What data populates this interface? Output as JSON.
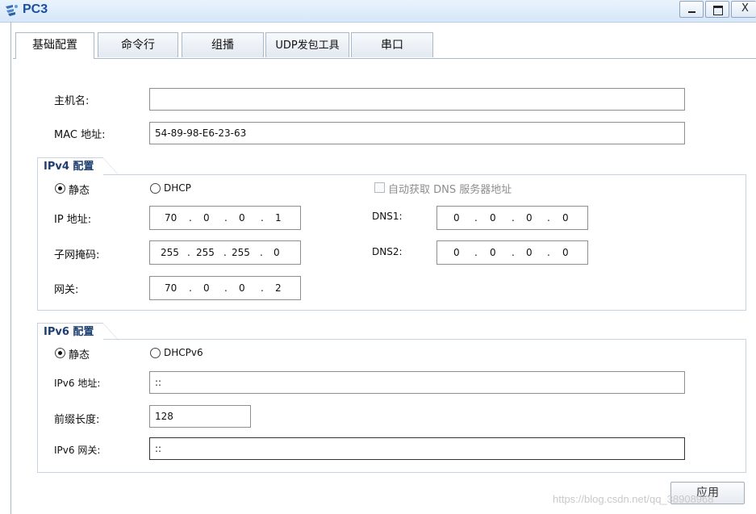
{
  "window": {
    "title": "PC3",
    "minimize_glyph": "_",
    "maximize_glyph": "□",
    "close_glyph": "X"
  },
  "tabs": [
    {
      "label": "基础配置",
      "active": true
    },
    {
      "label": "命令行",
      "active": false
    },
    {
      "label": "组播",
      "active": false
    },
    {
      "label": "UDP发包工具",
      "active": false
    },
    {
      "label": "串口",
      "active": false
    }
  ],
  "basic": {
    "hostname_label": "主机名:",
    "hostname_value": "",
    "mac_label": "MAC 地址:",
    "mac_value": "54-89-98-E6-23-63"
  },
  "ipv4": {
    "group_title": "IPv4 配置",
    "static_label": "静态",
    "dhcp_label": "DHCP",
    "mode": "static",
    "auto_dns_label": "自动获取 DNS 服务器地址",
    "ip_label": "IP 地址:",
    "ip": [
      "70",
      "0",
      "0",
      "1"
    ],
    "mask_label": "子网掩码:",
    "mask": [
      "255",
      "255",
      "255",
      "0"
    ],
    "gateway_label": "网关:",
    "gateway": [
      "70",
      "0",
      "0",
      "2"
    ],
    "dns1_label": "DNS1:",
    "dns1": [
      "0",
      "0",
      "0",
      "0"
    ],
    "dns2_label": "DNS2:",
    "dns2": [
      "0",
      "0",
      "0",
      "0"
    ]
  },
  "ipv6": {
    "group_title": "IPv6 配置",
    "static_label": "静态",
    "dhcp_label": "DHCPv6",
    "mode": "static",
    "address_label": "IPv6 地址:",
    "address_value": "::",
    "prefix_label": "前缀长度:",
    "prefix_value": "128",
    "gateway_label": "IPv6 网关:",
    "gateway_value": "::"
  },
  "apply_label": "应用",
  "watermark": "https://blog.csdn.net/qq_38908968",
  "colors": {
    "title": "#1d4fa0",
    "group_title": "#1d3f70",
    "border": "#8a8f96"
  },
  "icons": {
    "app": "network-device-icon"
  }
}
